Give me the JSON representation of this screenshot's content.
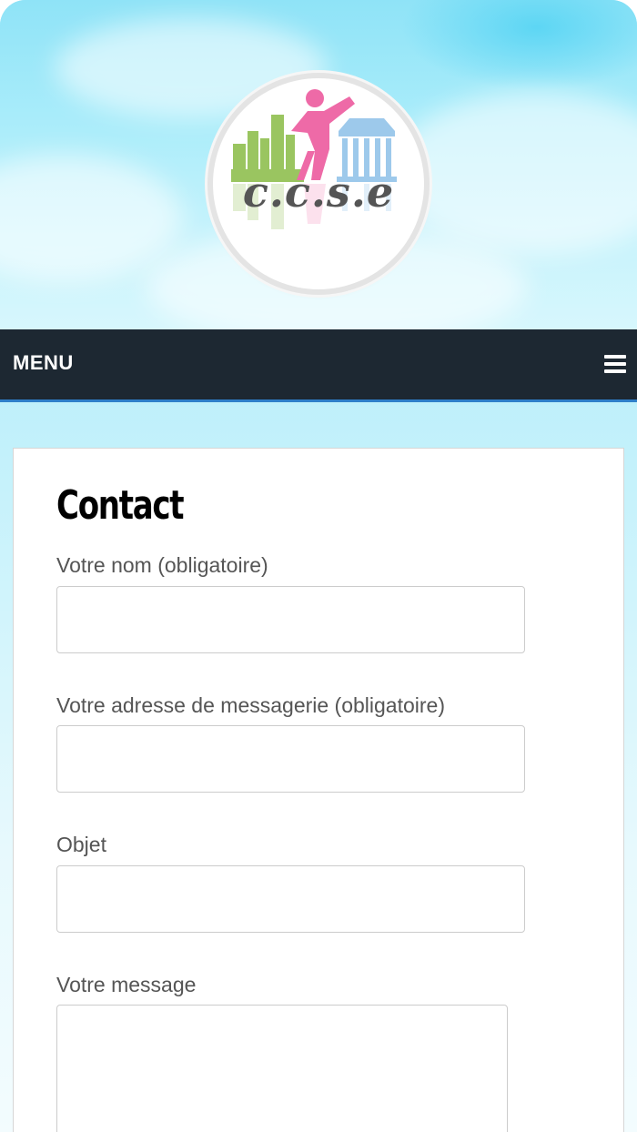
{
  "header": {
    "logo_text": "c.c.s.e"
  },
  "nav": {
    "menu_label": "MENU"
  },
  "page": {
    "title": "Contact"
  },
  "form": {
    "name_label": "Votre nom (obligatoire)",
    "name_value": "",
    "email_label": "Votre adresse de messagerie (obligatoire)",
    "email_value": "",
    "subject_label": "Objet",
    "subject_value": "",
    "message_label": "Votre message",
    "message_value": ""
  },
  "colors": {
    "menu_bar": "#1d2832",
    "menu_accent": "#2e7fc9",
    "sky": "#a8ecfa"
  },
  "icons": {
    "menu": "hamburger-icon"
  }
}
